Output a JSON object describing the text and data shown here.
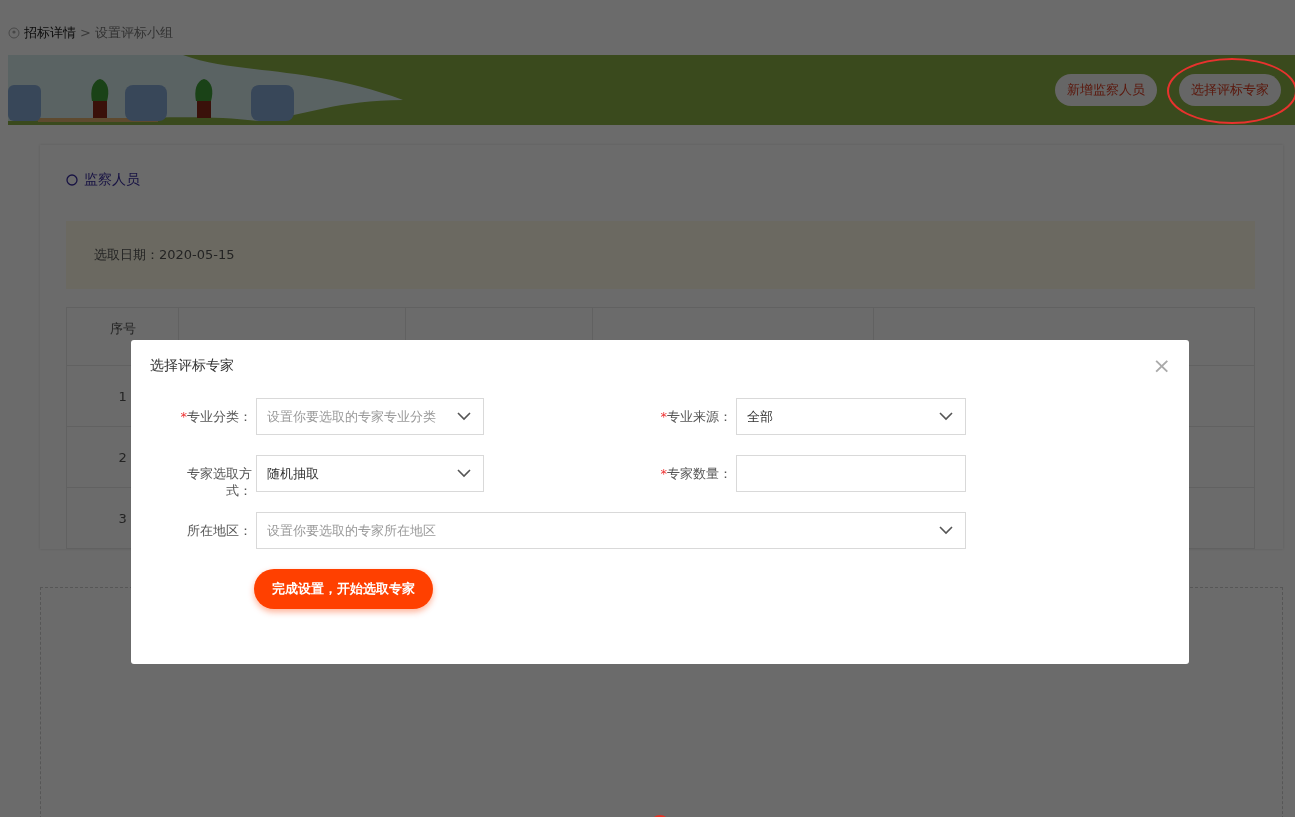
{
  "breadcrumb": {
    "parent": "招标详情",
    "separator": ">",
    "current": "设置评标小组"
  },
  "banner": {
    "buttons": [
      {
        "label": "新增监察人员",
        "highlighted": false
      },
      {
        "label": "选择评标专家",
        "highlighted": true
      }
    ]
  },
  "section": {
    "title": "监察人员",
    "info": "选取日期：2020-05-15"
  },
  "table": {
    "columns": [
      "序号"
    ],
    "rows": [
      {
        "no": "1"
      },
      {
        "no": "2"
      },
      {
        "no": "3"
      }
    ]
  },
  "dialog": {
    "title": "选择评标专家",
    "close": "×",
    "fields": [
      {
        "kind": "select",
        "mark": "*",
        "label": "专业分类：",
        "placeholder": "设置你要选取的专家专业分类"
      },
      {
        "kind": "select",
        "mark": "*",
        "label": "专业来源：",
        "value": "全部"
      },
      {
        "kind": "select",
        "label": "专家选取方式：",
        "value": "随机抽取"
      },
      {
        "kind": "input",
        "mark": "*",
        "label": "专家数量："
      },
      {
        "kind": "select-wide",
        "label": "所在地区：",
        "placeholder": "设置你要选取的专家所在地区"
      }
    ],
    "submit": "完成设置，开始选取专家"
  }
}
